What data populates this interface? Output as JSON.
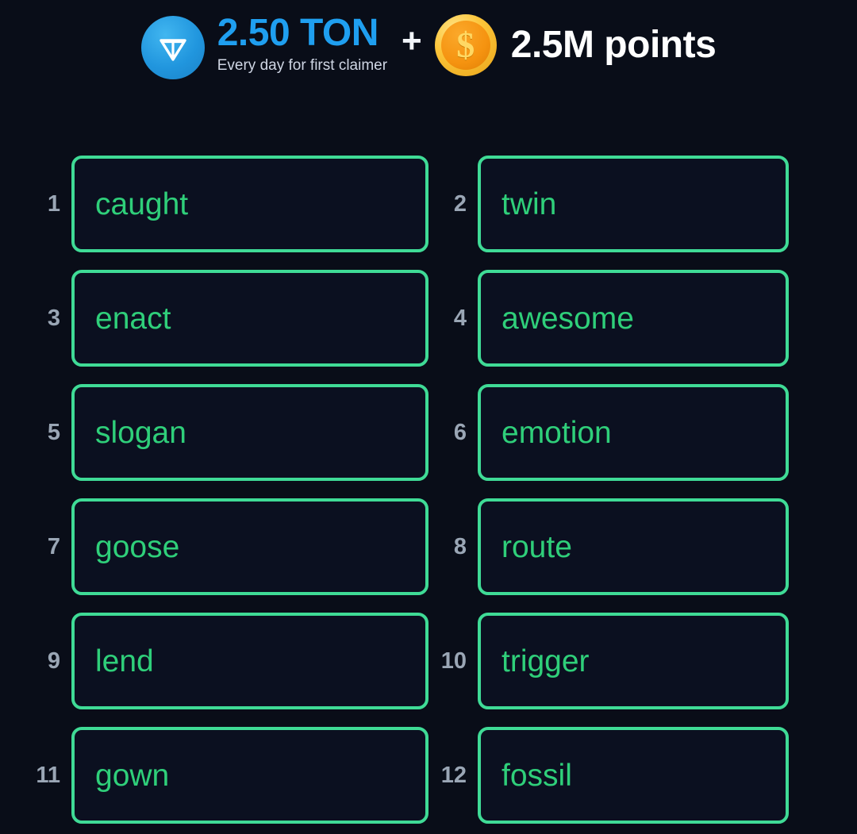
{
  "header": {
    "ton": {
      "icon": "ton-logo-icon",
      "amount": "2.50 TON",
      "subtitle": "Every day for first claimer",
      "color": "#1f9ff0"
    },
    "separator": "+",
    "points": {
      "icon": "gold-coin-icon",
      "glyph": "$",
      "amount": "2.5M points",
      "color": "#ffffff"
    }
  },
  "colors": {
    "background": "#090d18",
    "box_background": "#0b1020",
    "box_border": "#3fdb96",
    "word_text": "#2fcf7a",
    "index_text": "#9aa6b5",
    "ton_blue": "#1f9ff0",
    "coin_gold": "#fcc53a"
  },
  "words": [
    {
      "index": "1",
      "word": "caught"
    },
    {
      "index": "2",
      "word": "twin"
    },
    {
      "index": "3",
      "word": "enact"
    },
    {
      "index": "4",
      "word": "awesome"
    },
    {
      "index": "5",
      "word": "slogan"
    },
    {
      "index": "6",
      "word": "emotion"
    },
    {
      "index": "7",
      "word": "goose"
    },
    {
      "index": "8",
      "word": "route"
    },
    {
      "index": "9",
      "word": "lend"
    },
    {
      "index": "10",
      "word": "trigger"
    },
    {
      "index": "11",
      "word": "gown"
    },
    {
      "index": "12",
      "word": "fossil"
    }
  ]
}
